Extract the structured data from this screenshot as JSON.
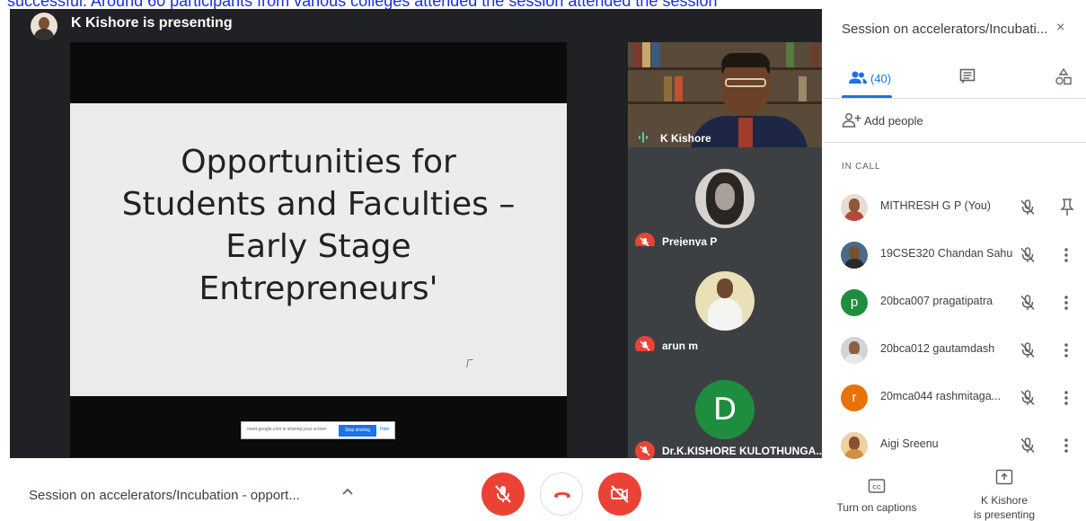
{
  "banner_text": "successful. Around 60 participants from various colleges attended the session attended the session",
  "presenter": {
    "label": "K Kishore is presenting"
  },
  "slide": {
    "title_lines": [
      "Opportunities for",
      "Students and Faculties –",
      "Early Stage",
      "Entrepreneurs'"
    ]
  },
  "share_bar": {
    "text": "meet.google.com is sharing your screen",
    "stop": "Stop sharing",
    "hide": "Hide"
  },
  "tiles": [
    {
      "name": "K Kishore",
      "state": "speaking"
    },
    {
      "name": "Prejenya P",
      "state": "muted"
    },
    {
      "name": "arun m",
      "state": "muted"
    },
    {
      "name": "Dr.K.KISHORE KULOTHUNGA...",
      "state": "muted",
      "initial": "D",
      "color": "#1e8e3e"
    }
  ],
  "side_panel": {
    "title": "Session on accelerators/Incubati...",
    "close": "×",
    "people_count": "(40)",
    "add_people": "Add people",
    "in_call": "IN CALL",
    "participants": [
      {
        "name": "MITHRESH G P (You)",
        "avatar": "photo",
        "action": "pin-icon"
      },
      {
        "name": "19CSE320 Chandan Sahu",
        "avatar": "photo",
        "action": "more-vert-icon"
      },
      {
        "name": "20bca007 pragatipatra",
        "avatar": "p",
        "color": "#1e8e3e",
        "action": "more-vert-icon"
      },
      {
        "name": "20bca012 gautamdash",
        "avatar": "photo",
        "action": "more-vert-icon"
      },
      {
        "name": "20mca044 rashmitaga...",
        "avatar": "r",
        "color": "#e8710a",
        "action": "more-vert-icon"
      },
      {
        "name": "Aigi Sreenu",
        "avatar": "photo",
        "action": "more-vert-icon"
      }
    ]
  },
  "bottom_bar": {
    "meeting_title": "Session on accelerators/Incubation - opport...",
    "captions": "Turn on captions",
    "presenting_line1": "K Kishore",
    "presenting_line2": "is presenting"
  },
  "colors": {
    "accent": "#1a73e8",
    "danger": "#ea4335",
    "stage": "#202124"
  }
}
